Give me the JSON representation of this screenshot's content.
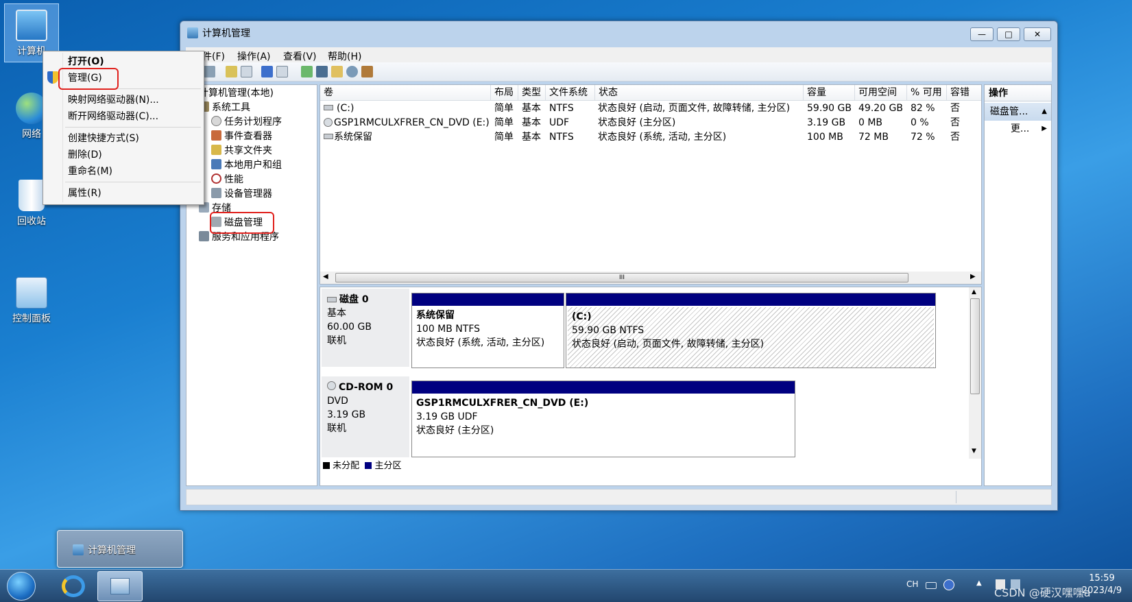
{
  "desktop": {
    "icons": [
      {
        "label": "计算机",
        "icon": "computer-icon"
      },
      {
        "label": "网络",
        "icon": "network-icon"
      },
      {
        "label": "回收站",
        "icon": "recycle-bin-icon"
      },
      {
        "label": "控制面板",
        "icon": "control-panel-icon"
      }
    ]
  },
  "context_menu": {
    "items": [
      "打开(O)",
      "管理(G)",
      "映射网络驱动器(N)...",
      "断开网络驱动器(C)...",
      "创建快捷方式(S)",
      "删除(D)",
      "重命名(M)",
      "属性(R)"
    ]
  },
  "window": {
    "title": "计算机管理",
    "minimize": "—",
    "maximize": "□",
    "close": "✕",
    "menu": [
      "文件(F)",
      "操作(A)",
      "查看(V)",
      "帮助(H)"
    ]
  },
  "tree": {
    "root": "计算机管理(本地)",
    "system_tools": "系统工具",
    "task_scheduler": "任务计划程序",
    "event_viewer": "事件查看器",
    "shared_folders": "共享文件夹",
    "local_users": "本地用户和组",
    "performance": "性能",
    "device_manager": "设备管理器",
    "storage": "存储",
    "disk_management": "磁盘管理",
    "services": "服务和应用程序"
  },
  "volume_list": {
    "columns": [
      "卷",
      "布局",
      "类型",
      "文件系统",
      "状态",
      "容量",
      "可用空间",
      "% 可用",
      "容错"
    ],
    "rows": [
      [
        "(C:)",
        "简单",
        "基本",
        "NTFS",
        "状态良好 (启动, 页面文件, 故障转储, 主分区)",
        "59.90 GB",
        "49.20 GB",
        "82 %",
        "否"
      ],
      [
        "GSP1RMCULXFRER_CN_DVD (E:)",
        "简单",
        "基本",
        "UDF",
        "状态良好 (主分区)",
        "3.19 GB",
        "0 MB",
        "0 %",
        "否"
      ],
      [
        "系统保留",
        "简单",
        "基本",
        "NTFS",
        "状态良好 (系统, 活动, 主分区)",
        "100 MB",
        "72 MB",
        "72 %",
        "否"
      ]
    ],
    "scroll_grip": "III"
  },
  "disks": {
    "disk0": {
      "name": "磁盘 0",
      "type": "基本",
      "size": "60.00 GB",
      "status": "联机",
      "p1": {
        "name": "系统保留",
        "fs": "100 MB NTFS",
        "state": "状态良好 (系统, 活动, 主分区)"
      },
      "p2": {
        "name": "(C:)",
        "fs": "59.90 GB NTFS",
        "state": "状态良好 (启动, 页面文件, 故障转储, 主分区)"
      }
    },
    "cdrom0": {
      "name": "CD-ROM 0",
      "type": "DVD",
      "size": "3.19 GB",
      "status": "联机",
      "p1": {
        "name": "GSP1RMCULXFRER_CN_DVD  (E:)",
        "fs": "3.19 GB UDF",
        "state": "状态良好 (主分区)"
      }
    },
    "legend": [
      "未分配",
      "主分区"
    ]
  },
  "actions": {
    "header": "操作",
    "section": "磁盘管...",
    "more": "更..."
  },
  "taskbar": {
    "popup": "计算机管理",
    "lang": "CH",
    "time": "15:59",
    "date": "2023/4/9",
    "watermark": "CSDN @硬汉嘿嘿a"
  },
  "colors": {
    "primary_partition": "#000080",
    "highlight": "#e0201c"
  }
}
